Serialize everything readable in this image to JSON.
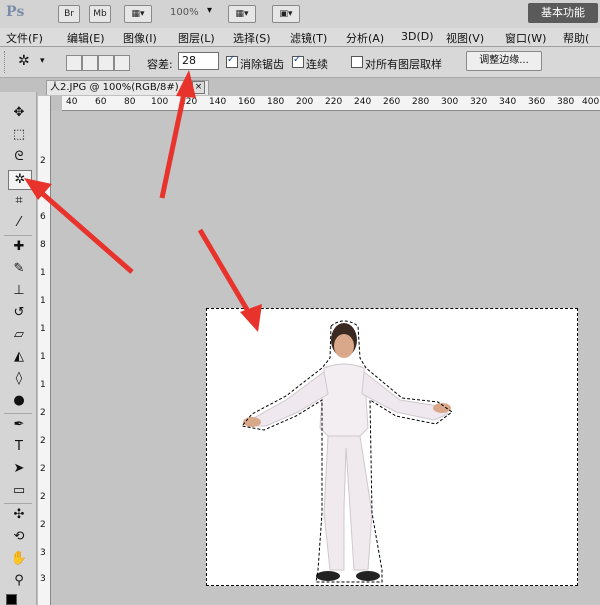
{
  "appbar": {
    "logo": "Ps",
    "btn_br": "Br",
    "btn_mb": "Mb",
    "zoom": "100%",
    "workspace": "基本功能"
  },
  "menu": [
    "文件(F)",
    "编辑(E)",
    "图像(I)",
    "图层(L)",
    "选择(S)",
    "滤镜(T)",
    "分析(A)",
    "3D(D)",
    "视图(V)",
    "窗口(W)",
    "帮助("
  ],
  "options": {
    "tolerance_label": "容差:",
    "tolerance_value": "28",
    "antialias_label": "消除锯齿",
    "antialias_checked": true,
    "contiguous_label": "连续",
    "contiguous_checked": true,
    "sample_all_label": "对所有图层取样",
    "sample_all_checked": false,
    "refine_edge": "调整边缘..."
  },
  "document": {
    "tab_title": "人2.JPG @ 100%(RGB/8#)",
    "close_glyph": "×"
  },
  "ruler": {
    "top_marks": [
      "40",
      "60",
      "80",
      "100",
      "120",
      "140",
      "160",
      "180",
      "200",
      "220",
      "240",
      "260",
      "280",
      "300",
      "320",
      "340",
      "360",
      "380",
      "400"
    ],
    "left_marks": [
      "2",
      "4",
      "6",
      "8",
      "1",
      "1",
      "1",
      "1",
      "1",
      "2",
      "2",
      "2",
      "2",
      "2",
      "3",
      "3",
      "3"
    ]
  },
  "tools": [
    {
      "name": "move-tool-icon",
      "glyph": "✥"
    },
    {
      "name": "marquee-tool-icon",
      "glyph": "⬚"
    },
    {
      "name": "lasso-tool-icon",
      "glyph": "ᘓ"
    },
    {
      "name": "magic-wand-tool-icon",
      "glyph": "✲",
      "active": true
    },
    {
      "name": "crop-tool-icon",
      "glyph": "⌗"
    },
    {
      "name": "eyedropper-tool-icon",
      "glyph": "⁄"
    },
    {
      "name": "healing-brush-tool-icon",
      "glyph": "✚"
    },
    {
      "name": "brush-tool-icon",
      "glyph": "✎"
    },
    {
      "name": "clone-stamp-tool-icon",
      "glyph": "⊥"
    },
    {
      "name": "history-brush-tool-icon",
      "glyph": "↺"
    },
    {
      "name": "eraser-tool-icon",
      "glyph": "▱"
    },
    {
      "name": "paint-bucket-tool-icon",
      "glyph": "◭"
    },
    {
      "name": "blur-tool-icon",
      "glyph": "◊"
    },
    {
      "name": "dodge-tool-icon",
      "glyph": "●"
    },
    {
      "name": "pen-tool-icon",
      "glyph": "✒"
    },
    {
      "name": "type-tool-icon",
      "glyph": "T"
    },
    {
      "name": "path-selection-tool-icon",
      "glyph": "➤"
    },
    {
      "name": "shape-tool-icon",
      "glyph": "▭"
    },
    {
      "name": "3d-rotate-tool-icon",
      "glyph": "✣"
    },
    {
      "name": "3d-orbit-tool-icon",
      "glyph": "⟲"
    },
    {
      "name": "hand-tool-icon",
      "glyph": "✋"
    },
    {
      "name": "zoom-tool-icon",
      "glyph": "⚲"
    }
  ],
  "colors": {
    "arrow": "#e8322c",
    "app_bg": "#c0c0c0",
    "canvas": "#ffffff"
  }
}
